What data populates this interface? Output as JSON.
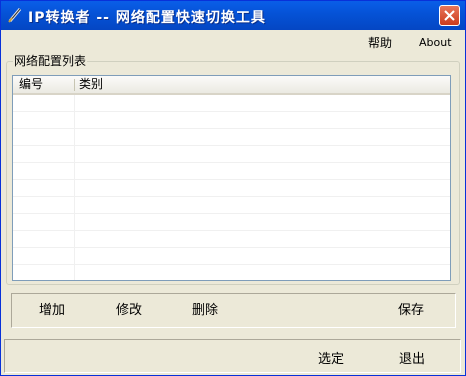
{
  "window": {
    "title": "IP转换者 -- 网络配置快速切换工具",
    "app_icon": "pen-icon",
    "close_icon": "close-icon"
  },
  "menu": {
    "help": "帮助",
    "about": "About"
  },
  "group": {
    "label": "网络配置列表"
  },
  "list": {
    "columns": [
      "编号",
      "类别"
    ],
    "rows": []
  },
  "toolbar": {
    "add": "增加",
    "edit": "修改",
    "delete": "删除",
    "save": "保存"
  },
  "footer": {
    "select": "选定",
    "exit": "退出"
  }
}
